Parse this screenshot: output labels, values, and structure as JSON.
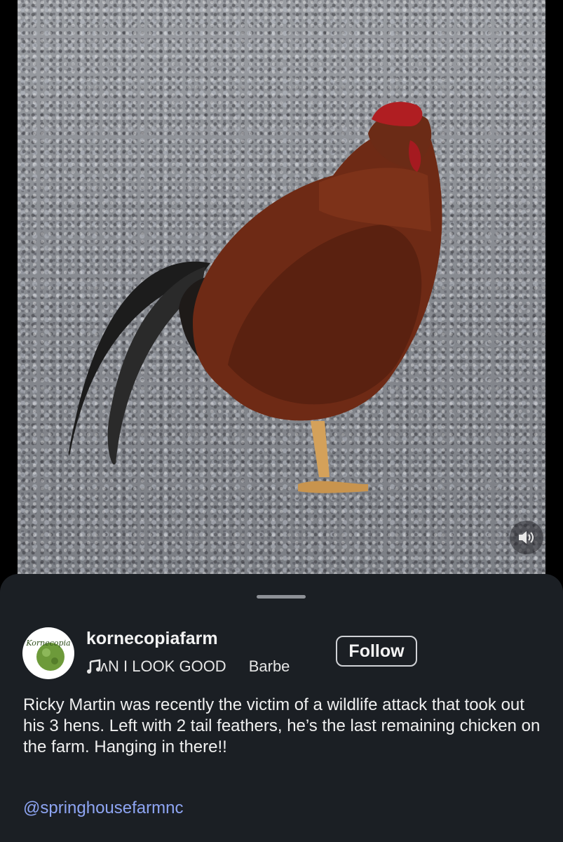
{
  "video": {
    "subject": "rooster on gravel",
    "mute_icon": "speaker-icon"
  },
  "sheet": {
    "account": {
      "username": "kornecopiafarm",
      "avatar_text": "Kornecopia"
    },
    "music": {
      "icon": "music-note-icon",
      "track": "ʌN I LOOK GOOD",
      "artist": "Barbe"
    },
    "follow_label": "Follow",
    "caption": "Ricky Martin was recently the victim of a wildlife attack that took out his 3 hens. Left with 2 tail feathers, he’s the last remaining chicken on the farm. Hanging in there!!",
    "mention": "@springhousefarmnc"
  },
  "colors": {
    "sheet_bg": "#1b1f24",
    "link": "#8ea5f3",
    "text": "#f0f0f0"
  }
}
